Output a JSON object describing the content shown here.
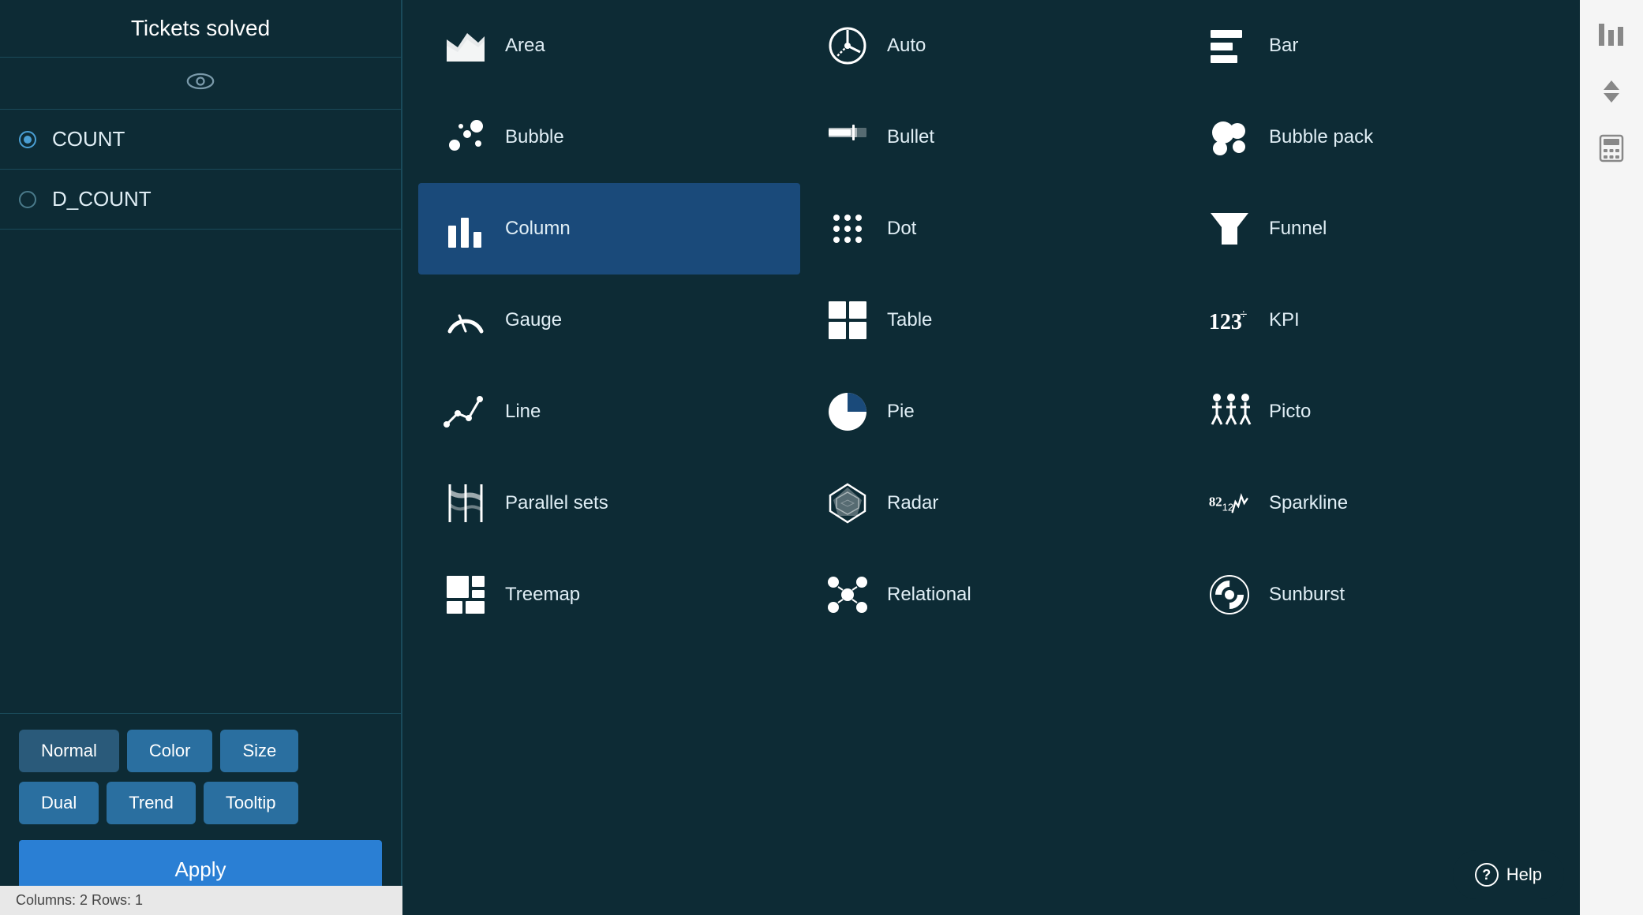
{
  "left_panel": {
    "title": "Tickets solved",
    "metrics": [
      {
        "id": "count",
        "label": "COUNT",
        "active": true
      },
      {
        "id": "dcount",
        "label": "D_COUNT",
        "active": false
      }
    ],
    "buttons_row1": [
      {
        "id": "normal",
        "label": "Normal",
        "style": "normal"
      },
      {
        "id": "color",
        "label": "Color",
        "style": "color"
      },
      {
        "id": "size",
        "label": "Size",
        "style": "size"
      }
    ],
    "buttons_row2": [
      {
        "id": "dual",
        "label": "Dual",
        "style": "dual"
      },
      {
        "id": "trend",
        "label": "Trend",
        "style": "trend"
      },
      {
        "id": "tooltip",
        "label": "Tooltip",
        "style": "tooltip"
      }
    ],
    "apply_label": "Apply"
  },
  "status_bar": {
    "text": "Columns: 2    Rows: 1"
  },
  "chart_types": [
    {
      "id": "area",
      "label": "Area",
      "selected": false
    },
    {
      "id": "auto",
      "label": "Auto",
      "selected": false
    },
    {
      "id": "bar",
      "label": "Bar",
      "selected": false
    },
    {
      "id": "bubble",
      "label": "Bubble",
      "selected": false
    },
    {
      "id": "bullet",
      "label": "Bullet",
      "selected": false
    },
    {
      "id": "bubble-pack",
      "label": "Bubble pack",
      "selected": false
    },
    {
      "id": "column",
      "label": "Column",
      "selected": true
    },
    {
      "id": "dot",
      "label": "Dot",
      "selected": false
    },
    {
      "id": "funnel",
      "label": "Funnel",
      "selected": false
    },
    {
      "id": "gauge",
      "label": "Gauge",
      "selected": false
    },
    {
      "id": "table",
      "label": "Table",
      "selected": false
    },
    {
      "id": "kpi",
      "label": "KPI",
      "selected": false
    },
    {
      "id": "line",
      "label": "Line",
      "selected": false
    },
    {
      "id": "pie",
      "label": "Pie",
      "selected": false
    },
    {
      "id": "picto",
      "label": "Picto",
      "selected": false
    },
    {
      "id": "parallel-sets",
      "label": "Parallel sets",
      "selected": false
    },
    {
      "id": "radar",
      "label": "Radar",
      "selected": false
    },
    {
      "id": "sparkline",
      "label": "Sparkline",
      "selected": false
    },
    {
      "id": "treemap",
      "label": "Treemap",
      "selected": false
    },
    {
      "id": "relational",
      "label": "Relational",
      "selected": false
    },
    {
      "id": "sunburst",
      "label": "Sunburst",
      "selected": false
    }
  ],
  "right_panel": {
    "icons": [
      "bar-chart-icon",
      "sort-icon",
      "calculator-icon"
    ]
  },
  "help_button": {
    "label": "Help"
  }
}
